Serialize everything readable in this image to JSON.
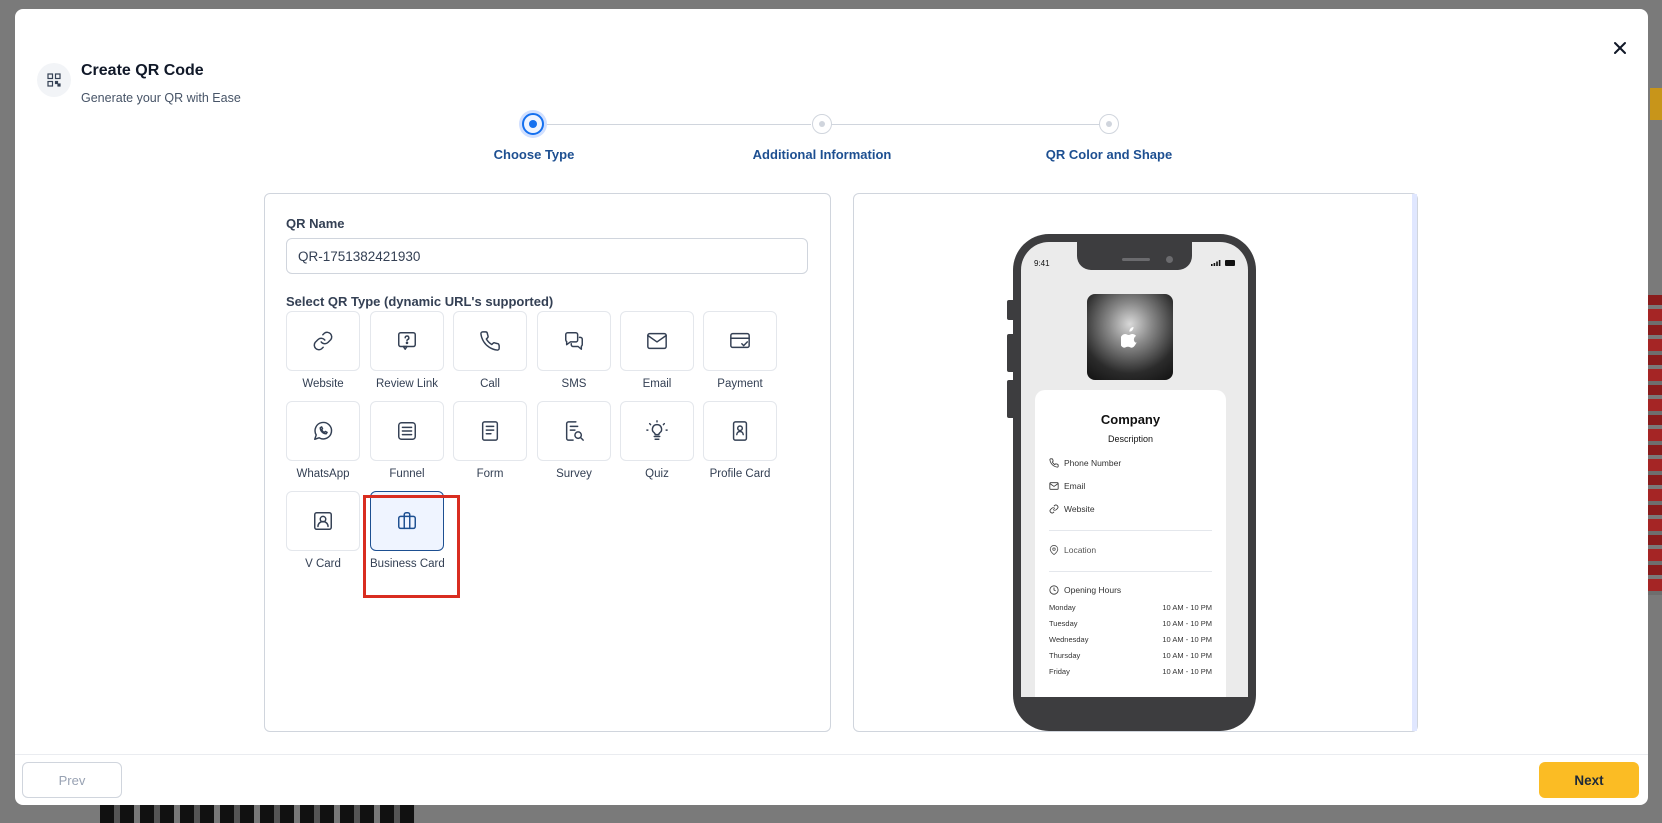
{
  "modal": {
    "title": "Create QR Code",
    "subtitle": "Generate your QR with Ease"
  },
  "steps": [
    {
      "label": "Choose Type",
      "state": "active"
    },
    {
      "label": "Additional Information",
      "state": "pending"
    },
    {
      "label": "QR Color and Shape",
      "state": "pending"
    }
  ],
  "form": {
    "name_label": "QR Name",
    "name_value": "QR-1751382421930",
    "type_label": "Select QR Type (dynamic URL's supported)"
  },
  "qr_types": [
    {
      "label": "Website",
      "icon": "link-icon"
    },
    {
      "label": "Review Link",
      "icon": "review-icon"
    },
    {
      "label": "Call",
      "icon": "phone-icon"
    },
    {
      "label": "SMS",
      "icon": "chat-icon"
    },
    {
      "label": "Email",
      "icon": "mail-icon"
    },
    {
      "label": "Payment",
      "icon": "card-icon"
    },
    {
      "label": "WhatsApp",
      "icon": "whatsapp-icon"
    },
    {
      "label": "Funnel",
      "icon": "funnel-icon"
    },
    {
      "label": "Form",
      "icon": "form-icon"
    },
    {
      "label": "Survey",
      "icon": "survey-icon"
    },
    {
      "label": "Quiz",
      "icon": "bulb-icon"
    },
    {
      "label": "Profile Card",
      "icon": "profile-card-icon"
    },
    {
      "label": "V Card",
      "icon": "vcard-icon"
    },
    {
      "label": "Business Card",
      "icon": "briefcase-icon",
      "selected": true
    }
  ],
  "preview": {
    "time": "9:41",
    "company": "Company",
    "description": "Description",
    "phone": "Phone Number",
    "email": "Email",
    "website": "Website",
    "location": "Location",
    "hours_title": "Opening Hours",
    "hours": [
      {
        "day": "Monday",
        "time": "10 AM - 10 PM"
      },
      {
        "day": "Tuesday",
        "time": "10 AM - 10 PM"
      },
      {
        "day": "Wednesday",
        "time": "10 AM - 10 PM"
      },
      {
        "day": "Thursday",
        "time": "10 AM - 10 PM"
      },
      {
        "day": "Friday",
        "time": "10 AM - 10 PM"
      }
    ]
  },
  "footer": {
    "prev": "Prev",
    "next": "Next"
  },
  "colors": {
    "accent": "#1d4f91",
    "next_button": "#fbbc24",
    "highlight": "#d92d20"
  }
}
